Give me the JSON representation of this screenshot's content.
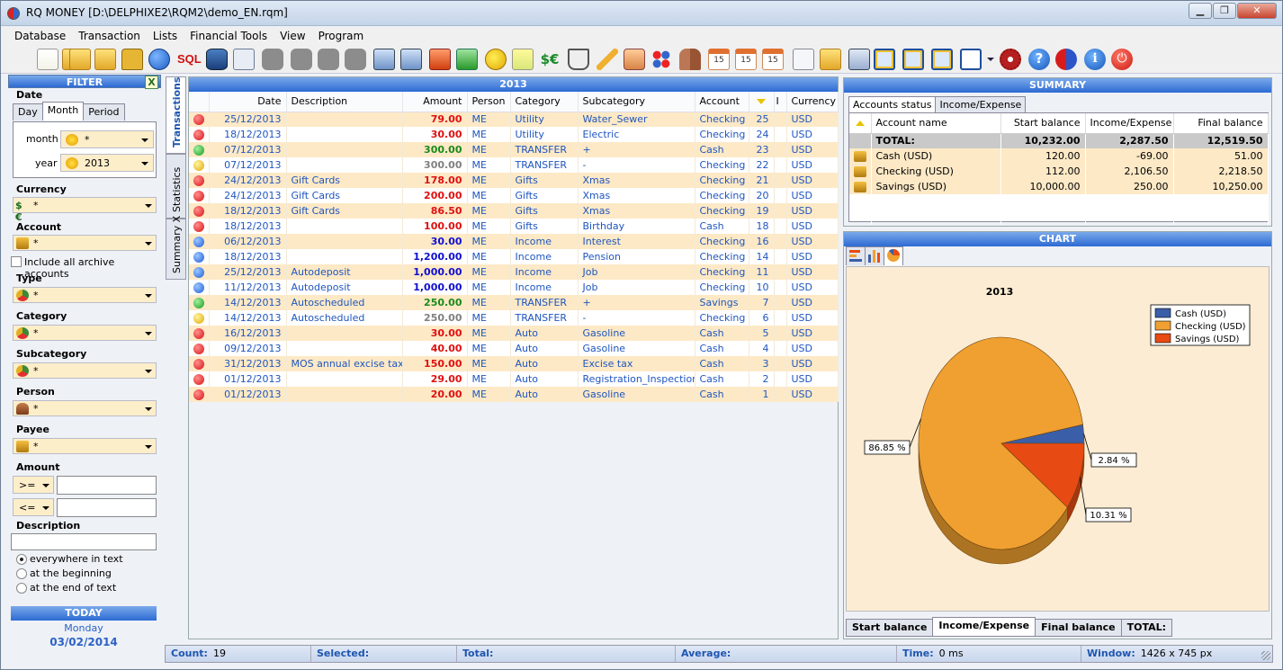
{
  "window": {
    "title": "RQ MONEY [D:\\DELPHIXE2\\RQM2\\demo_EN.rqm]"
  },
  "menu": [
    "Database",
    "Transaction",
    "Lists",
    "Financial Tools",
    "View",
    "Program"
  ],
  "toolbar": {
    "icons": [
      "new-document-icon",
      "open-folder-icon",
      "import-folder-icon",
      "export-folder-icon",
      "lock-icon",
      "play-circle-icon",
      "sql-icon",
      "database-icon",
      "card-icon",
      "comment-icon",
      "comment-icon",
      "comment-icon",
      "comment-icon",
      "stack-icon",
      "stack-icon",
      "upload-icon",
      "download-icon",
      "smiley-icon",
      "strip-icon",
      "currency-icon",
      "cart-icon",
      "pencil-icon",
      "person-icon",
      "dots-icon",
      "people-icon",
      "calendar-icon",
      "calendar-icon",
      "calendar-icon",
      "graph-icon",
      "coins-icon",
      "calculator-icon",
      "layout-left-icon",
      "layout-top-icon",
      "layout-bottom-icon",
      "layout-right-icon",
      "gear-icon",
      "help-icon",
      "ball-icon",
      "info-icon",
      "power-icon"
    ],
    "calendar_label": "15",
    "sql_label": "SQL",
    "money_label": "$€",
    "help_label": "?",
    "info_label": "i",
    "power_label": "⏻"
  },
  "filter": {
    "title": "FILTER",
    "close_label": "X",
    "date": {
      "label": "Date",
      "tabs": [
        "Day",
        "Month",
        "Period"
      ],
      "active_tab": "Month",
      "month_label": "month",
      "month_value": "*",
      "year_label": "year",
      "year_value": "2013"
    },
    "currency": {
      "label": "Currency",
      "value": "*",
      "prefix": "$€"
    },
    "account": {
      "label": "Account",
      "value": "*",
      "archive_label": "Include all archive accounts"
    },
    "type": {
      "label": "Type",
      "value": "*"
    },
    "category": {
      "label": "Category",
      "value": "*"
    },
    "subcategory": {
      "label": "Subcategory",
      "value": "*"
    },
    "person": {
      "label": "Person",
      "value": "*"
    },
    "payee": {
      "label": "Payee",
      "value": "*"
    },
    "amount": {
      "label": "Amount",
      "op1": ">=",
      "op2": "<=",
      "val1": "",
      "val2": ""
    },
    "description": {
      "label": "Description",
      "value": "",
      "options": [
        "everywhere in text",
        "at the beginning",
        "at the end of text"
      ],
      "selected": 0
    },
    "today": {
      "label": "TODAY",
      "weekday": "Monday",
      "date": "03/02/2014"
    }
  },
  "side_tabs": [
    "Transactions",
    "Statistics",
    "Summary X"
  ],
  "transactions": {
    "title": "2013",
    "columns": [
      "",
      "Date",
      "Description",
      "Amount",
      "Person",
      "Category",
      "Subcategory",
      "Account",
      "",
      "I",
      "Currency"
    ],
    "rows": [
      {
        "status": "red",
        "date": "25/12/2013",
        "desc": "",
        "amount": "79.00",
        "color": "#e01010",
        "person": "ME",
        "category": "Utility",
        "subcategory": "Water_Sewer",
        "account": "Checking",
        "id": "25",
        "currency": "USD"
      },
      {
        "status": "red",
        "date": "18/12/2013",
        "desc": "",
        "amount": "30.00",
        "color": "#e01010",
        "person": "ME",
        "category": "Utility",
        "subcategory": "Electric",
        "account": "Checking",
        "id": "24",
        "currency": "USD"
      },
      {
        "status": "green",
        "date": "07/12/2013",
        "desc": "",
        "amount": "300.00",
        "color": "#1a8a1a",
        "person": "ME",
        "category": "TRANSFER",
        "subcategory": "+",
        "account": "Cash",
        "id": "23",
        "currency": "USD"
      },
      {
        "status": "yellow",
        "date": "07/12/2013",
        "desc": "",
        "amount": "300.00",
        "color": "#808080",
        "person": "ME",
        "category": "TRANSFER",
        "subcategory": "-",
        "account": "Checking",
        "id": "22",
        "currency": "USD"
      },
      {
        "status": "red",
        "date": "24/12/2013",
        "desc": "Gift Cards",
        "amount": "178.00",
        "color": "#e01010",
        "person": "ME",
        "category": "Gifts",
        "subcategory": "Xmas",
        "account": "Checking",
        "id": "21",
        "currency": "USD"
      },
      {
        "status": "red",
        "date": "24/12/2013",
        "desc": "Gift Cards",
        "amount": "200.00",
        "color": "#e01010",
        "person": "ME",
        "category": "Gifts",
        "subcategory": "Xmas",
        "account": "Checking",
        "id": "20",
        "currency": "USD"
      },
      {
        "status": "red",
        "date": "18/12/2013",
        "desc": "Gift Cards",
        "amount": "86.50",
        "color": "#e01010",
        "person": "ME",
        "category": "Gifts",
        "subcategory": "Xmas",
        "account": "Checking",
        "id": "19",
        "currency": "USD"
      },
      {
        "status": "red",
        "date": "18/12/2013",
        "desc": "",
        "amount": "100.00",
        "color": "#e01010",
        "person": "ME",
        "category": "Gifts",
        "subcategory": "Birthday",
        "account": "Cash",
        "id": "18",
        "currency": "USD"
      },
      {
        "status": "blue",
        "date": "06/12/2013",
        "desc": "",
        "amount": "30.00",
        "color": "#1010d0",
        "person": "ME",
        "category": "Income",
        "subcategory": "Interest",
        "account": "Checking",
        "id": "16",
        "currency": "USD"
      },
      {
        "status": "blue",
        "date": "18/12/2013",
        "desc": "",
        "amount": "1,200.00",
        "color": "#1010d0",
        "person": "ME",
        "category": "Income",
        "subcategory": "Pension",
        "account": "Checking",
        "id": "14",
        "currency": "USD"
      },
      {
        "status": "blue",
        "date": "25/12/2013",
        "desc": "Autodeposit",
        "amount": "1,000.00",
        "color": "#1010d0",
        "person": "ME",
        "category": "Income",
        "subcategory": "Job",
        "account": "Checking",
        "id": "11",
        "currency": "USD"
      },
      {
        "status": "blue",
        "date": "11/12/2013",
        "desc": "Autodeposit",
        "amount": "1,000.00",
        "color": "#1010d0",
        "person": "ME",
        "category": "Income",
        "subcategory": "Job",
        "account": "Checking",
        "id": "10",
        "currency": "USD"
      },
      {
        "status": "green",
        "date": "14/12/2013",
        "desc": "Autoscheduled",
        "amount": "250.00",
        "color": "#1a8a1a",
        "person": "ME",
        "category": "TRANSFER",
        "subcategory": "+",
        "account": "Savings",
        "id": "7",
        "currency": "USD"
      },
      {
        "status": "yellow",
        "date": "14/12/2013",
        "desc": "Autoscheduled",
        "amount": "250.00",
        "color": "#808080",
        "person": "ME",
        "category": "TRANSFER",
        "subcategory": "-",
        "account": "Checking",
        "id": "6",
        "currency": "USD"
      },
      {
        "status": "red",
        "date": "16/12/2013",
        "desc": "",
        "amount": "30.00",
        "color": "#e01010",
        "person": "ME",
        "category": "Auto",
        "subcategory": "Gasoline",
        "account": "Cash",
        "id": "5",
        "currency": "USD"
      },
      {
        "status": "red",
        "date": "09/12/2013",
        "desc": "",
        "amount": "40.00",
        "color": "#e01010",
        "person": "ME",
        "category": "Auto",
        "subcategory": "Gasoline",
        "account": "Cash",
        "id": "4",
        "currency": "USD"
      },
      {
        "status": "red",
        "date": "31/12/2013",
        "desc": "MOS annual excise tax",
        "amount": "150.00",
        "color": "#e01010",
        "person": "ME",
        "category": "Auto",
        "subcategory": "Excise tax",
        "account": "Cash",
        "id": "3",
        "currency": "USD"
      },
      {
        "status": "red",
        "date": "01/12/2013",
        "desc": "",
        "amount": "29.00",
        "color": "#e01010",
        "person": "ME",
        "category": "Auto",
        "subcategory": "Registration_Inspection",
        "account": "Cash",
        "id": "2",
        "currency": "USD"
      },
      {
        "status": "red",
        "date": "01/12/2013",
        "desc": "",
        "amount": "20.00",
        "color": "#e01010",
        "person": "ME",
        "category": "Auto",
        "subcategory": "Gasoline",
        "account": "Cash",
        "id": "1",
        "currency": "USD"
      }
    ]
  },
  "summary": {
    "title": "SUMMARY",
    "tabs": [
      "Accounts status",
      "Income/Expense"
    ],
    "columns": [
      "Account name",
      "Start balance",
      "Income/Expense",
      "Final balance"
    ],
    "total": {
      "name": "TOTAL:",
      "start": "10,232.00",
      "ie": "2,287.50",
      "final": "12,519.50"
    },
    "rows": [
      {
        "name": "Cash (USD)",
        "start": "120.00",
        "ie": "-69.00",
        "final": "51.00"
      },
      {
        "name": "Checking (USD)",
        "start": "112.00",
        "ie": "2,106.50",
        "final": "2,218.50"
      },
      {
        "name": "Savings (USD)",
        "start": "10,000.00",
        "ie": "250.00",
        "final": "10,250.00"
      }
    ]
  },
  "chart_panel": {
    "title": "CHART",
    "bottom_tabs": [
      "Start balance",
      "Income/Expense",
      "Final balance",
      "TOTAL:"
    ],
    "active_bottom_tab": "Income/Expense"
  },
  "chart_data": {
    "type": "pie",
    "title": "2013",
    "legend_position": "top-right",
    "slices": [
      {
        "name": "Cash (USD)",
        "value": 2.84,
        "label": "2.84 %",
        "color": "#3a5ea8"
      },
      {
        "name": "Checking (USD)",
        "value": 86.85,
        "label": "86.85 %",
        "color": "#f0a030"
      },
      {
        "name": "Savings (USD)",
        "value": 10.31,
        "label": "10.31 %",
        "color": "#e84a14"
      }
    ]
  },
  "status": {
    "count_label": "Count:",
    "count": "19",
    "selected_label": "Selected:",
    "selected": "",
    "total_label": "Total:",
    "total": "",
    "average_label": "Average:",
    "average": "",
    "time_label": "Time:",
    "time": "0 ms",
    "window_label": "Window:",
    "window": "1426 x 745 px"
  }
}
